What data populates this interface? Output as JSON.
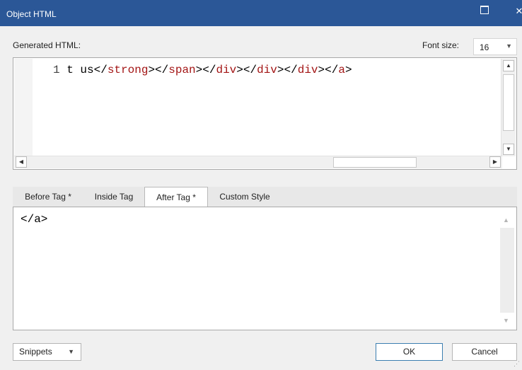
{
  "window": {
    "title": "Object HTML"
  },
  "generated": {
    "label": "Generated HTML:",
    "font_size_label": "Font size:",
    "font_size_value": "16",
    "line_number": "1",
    "code_segments": [
      {
        "text": "t us",
        "kind": "text"
      },
      {
        "text": "</",
        "kind": "text"
      },
      {
        "text": "strong",
        "kind": "tag"
      },
      {
        "text": "></",
        "kind": "text"
      },
      {
        "text": "span",
        "kind": "tag"
      },
      {
        "text": "></",
        "kind": "text"
      },
      {
        "text": "div",
        "kind": "tag"
      },
      {
        "text": "></",
        "kind": "text"
      },
      {
        "text": "div",
        "kind": "tag"
      },
      {
        "text": "></",
        "kind": "text"
      },
      {
        "text": "div",
        "kind": "tag"
      },
      {
        "text": "></",
        "kind": "text"
      },
      {
        "text": "a",
        "kind": "tag"
      },
      {
        "text": ">",
        "kind": "text"
      }
    ]
  },
  "tabs": [
    {
      "label": "Before Tag *",
      "active": false
    },
    {
      "label": "Inside Tag",
      "active": false
    },
    {
      "label": "After Tag *",
      "active": true
    },
    {
      "label": "Custom Style",
      "active": false
    }
  ],
  "tag_editor": {
    "content": "</a>"
  },
  "buttons": {
    "snippets": "Snippets",
    "ok": "OK",
    "cancel": "Cancel"
  },
  "colors": {
    "titlebar": "#2b5797",
    "tag": "#a31515",
    "ok_border": "#3c7fb1"
  }
}
